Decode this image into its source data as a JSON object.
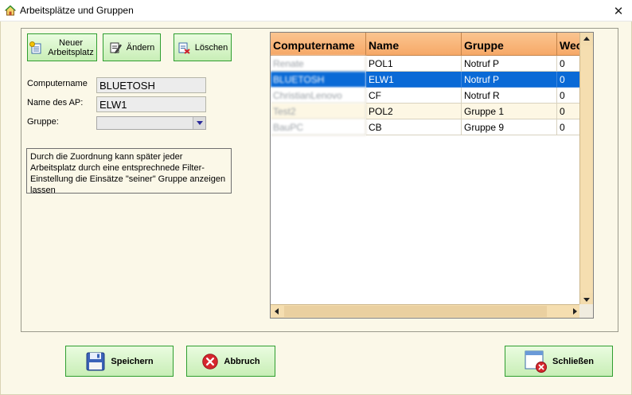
{
  "window": {
    "title": "Arbeitsplätze und Gruppen",
    "close_glyph": "✕"
  },
  "toolbar": {
    "new_label": "Neuer Arbeitsplatz",
    "edit_label": "Ändern",
    "delete_label": "Löschen"
  },
  "form": {
    "computername_label": "Computername",
    "computername_value": "BLUETOSH",
    "ap_name_label": "Name des AP:",
    "ap_name_value": "ELW1",
    "group_label": "Gruppe:",
    "group_value": ""
  },
  "note": "Durch die Zuordnung kann später jeder Arbeitsplatz durch eine entsprechnede Filter-Einstellung die Einsätze \"seiner\" Gruppe anzeigen lassen",
  "grid": {
    "columns": [
      "Computername",
      "Name",
      "Gruppe",
      "Wec"
    ],
    "rows": [
      {
        "computername": "Renate",
        "name": "POL1",
        "gruppe": "Notruf P",
        "wec": "0",
        "selected": false
      },
      {
        "computername": "BLUETOSH",
        "name": "ELW1",
        "gruppe": "Notruf P",
        "wec": "0",
        "selected": true
      },
      {
        "computername": "ChristianLenovo",
        "name": "CF",
        "gruppe": "Notruf R",
        "wec": "0",
        "selected": false
      },
      {
        "computername": "Test2",
        "name": "POL2",
        "gruppe": "Gruppe 1",
        "wec": "0",
        "selected": false
      },
      {
        "computername": "BauPC",
        "name": "CB",
        "gruppe": "Gruppe 9",
        "wec": "0",
        "selected": false
      }
    ]
  },
  "footer": {
    "save_label": "Speichern",
    "cancel_label": "Abbruch",
    "close_label": "Schließen"
  },
  "colors": {
    "button_border": "#2f9e2f",
    "header_fill": "#f6a867",
    "selection": "#0a6ad6",
    "background": "#fbf8e8"
  },
  "icons": {
    "app": "house-icon",
    "new": "new-document-icon",
    "edit": "edit-icon",
    "delete": "delete-icon",
    "save": "floppy-disk-icon",
    "cancel": "cancel-circle-icon",
    "close": "window-close-icon"
  }
}
